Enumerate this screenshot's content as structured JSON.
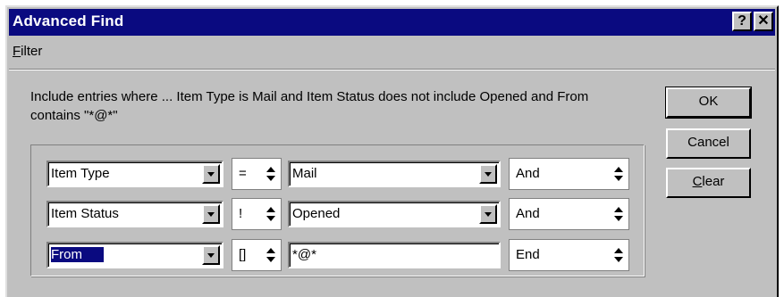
{
  "window": {
    "title": "Advanced Find"
  },
  "titlebar": {
    "help_glyph": "?",
    "close_glyph": "✕"
  },
  "menu": {
    "filter_label": "Filter",
    "filter_accel": "F",
    "filter_rest": "ilter"
  },
  "summary_text": "Include entries where ... Item Type is Mail and Item Status does not include Opened and From  contains \"*@*\"",
  "rows": [
    {
      "field": "Item Type",
      "operator": "=",
      "value": "Mail",
      "conjunction": "And"
    },
    {
      "field": "Item Status",
      "operator": "!",
      "value": "Opened",
      "conjunction": "And"
    },
    {
      "field": "From",
      "operator": "[]",
      "value": "*@*",
      "conjunction": "End"
    }
  ],
  "buttons": {
    "ok": "OK",
    "cancel": "Cancel",
    "clear": "Clear",
    "clear_accel": "C",
    "clear_rest": "lear"
  },
  "colors": {
    "titlebar": "#0a0a80",
    "face": "#c0c0c0",
    "selection": "#0a0a80"
  }
}
